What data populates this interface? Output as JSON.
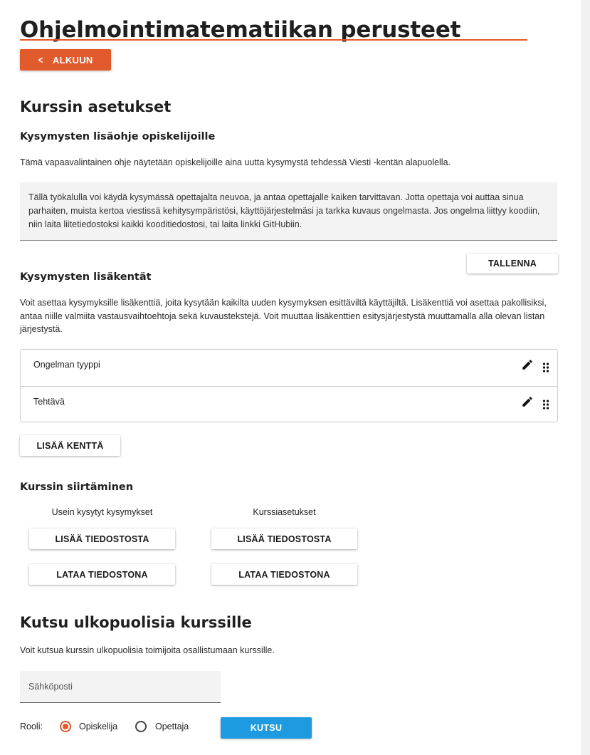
{
  "header": {
    "course_title": "Ohjelmointimatematiikan perusteet",
    "back_label": "ALKUUN"
  },
  "settings": {
    "title": "Kurssin asetukset",
    "instructions": {
      "title": "Kysymysten lisäohje opiskelijoille",
      "description": "Tämä vapaavalintainen ohje näytetään opiskelijoille aina uutta kysymystä tehdessä Viesti -kentän alapuolella.",
      "text": "Tällä työkalulla voi käydä kysymässä opettajalta neuvoa, ja antaa opettajalle kaiken tarvittavan. Jotta opettaja voi auttaa sinua parhaiten, muista kertoa viestissä kehitysympäristösi, käyttöjärjestelmäsi ja tarkka kuvaus ongelmasta. Jos ongelma liittyy koodiin, niin laita liitetiedostoksi kaikki kooditiedostosi, tai laita linkki GitHubiin.",
      "save_label": "TALLENNA"
    },
    "fields": {
      "title": "Kysymysten lisäkentät",
      "description": "Voit asettaa kysymyksille lisäkenttiä, joita kysytään kaikilta uuden kysymyksen esittäviltä käyttäjiltä. Lisäkenttiä voi asettaa pakollisiksi, antaa niille valmiita vastausvaihtoehtoja sekä kuvaustekstejä. Voit muuttaa lisäkenttien esitysjärjestystä muuttamalla alla olevan listan järjestystä.",
      "items": [
        {
          "name": "Ongelman tyyppi"
        },
        {
          "name": "Tehtävä"
        }
      ],
      "add_label": "LISÄÄ KENTTÄ"
    },
    "transfer": {
      "title": "Kurssin siirtäminen",
      "faq_label": "Usein kysytyt kysymykset",
      "settings_label": "Kurssiasetukset",
      "import_label": "LISÄÄ TIEDOSTOSTA",
      "export_label": "LATAA TIEDOSTONA"
    }
  },
  "invite": {
    "title": "Kutsu ulkopuolisia kurssille",
    "description": "Voit kutsua kurssin ulkopuolisia toimijoita osallistumaan kurssille.",
    "email_placeholder": "Sähköposti",
    "role_label": "Rooli:",
    "roles": [
      {
        "label": "Opiskelija",
        "selected": true
      },
      {
        "label": "Opettaja",
        "selected": false
      }
    ],
    "invite_label": "KUTSU"
  },
  "colors": {
    "accent_orange": "#e05a2b",
    "accent_blue": "#1e9be0"
  },
  "icons": {
    "back": "chevron-left-icon",
    "edit": "pencil-icon",
    "drag": "drag-handle-icon"
  }
}
